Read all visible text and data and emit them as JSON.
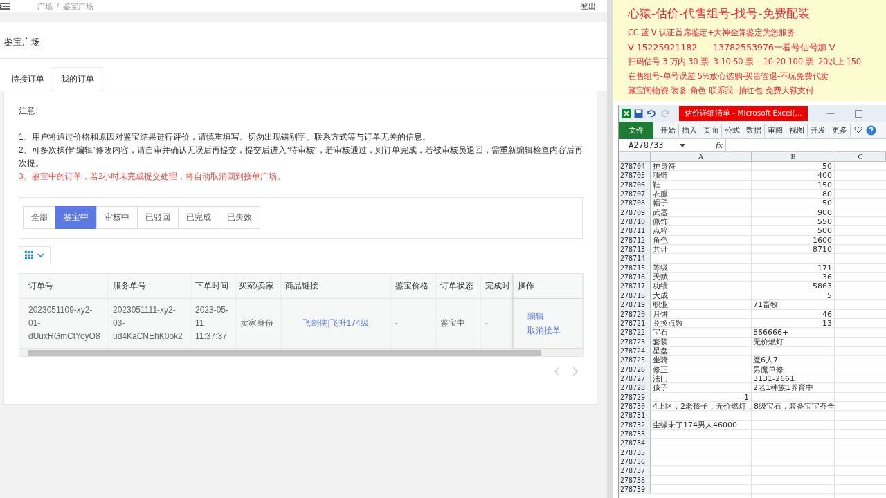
{
  "header": {
    "breadcrumb": [
      "广场",
      "鉴宝广场"
    ],
    "separator": "/",
    "logout": "登出"
  },
  "page_title": "鉴宝广场",
  "tabs": [
    {
      "label": "待接订单",
      "selected": false
    },
    {
      "label": "我的订单",
      "selected": true
    }
  ],
  "notice": {
    "heading": "注意:",
    "items": [
      {
        "text": "1、用户将通过价格和原因对鉴宝结果进行评价，请慎重填写。切勿出现错别字、联系方式等与订单无关的信息。",
        "warning": false
      },
      {
        "text": "2、可多次操作“编辑”修改内容，请自审并确认无误后再提交，提交后进入“待审核”，若审核通过，则订单完成，若被审核员退回，需重新编辑检查内容后再次提。",
        "warning": false
      },
      {
        "text": "3、鉴宝中的订单，若2小时未完成提交处理，将自动取消回到接单广场。",
        "warning": true
      }
    ]
  },
  "filters": [
    {
      "label": "全部",
      "selected": false
    },
    {
      "label": "鉴宝中",
      "selected": true
    },
    {
      "label": "审核中",
      "selected": false
    },
    {
      "label": "已驳回",
      "selected": false
    },
    {
      "label": "已完成",
      "selected": false
    },
    {
      "label": "已失效",
      "selected": false
    }
  ],
  "table": {
    "columns": [
      "订单号",
      "服务单号",
      "下单时间",
      "买家/卖家",
      "商品链接",
      "鉴宝价格",
      "订单状态",
      "完成时",
      "操作"
    ],
    "rows": [
      {
        "cells": [
          {
            "kind": "text",
            "text": "2023051109-xy2-01-dUuxRGmCtYoyO8"
          },
          {
            "kind": "text",
            "text": "2023051111-xy2-03-ud4KaCNEhK0ok2"
          },
          {
            "kind": "text",
            "text": "2023-05-11 11:37:37"
          },
          {
            "kind": "text",
            "text": "卖家身份"
          },
          {
            "kind": "link",
            "text": "飞剑侠|飞升174级"
          },
          {
            "kind": "muted",
            "text": "-"
          },
          {
            "kind": "text",
            "text": "鉴宝中"
          },
          {
            "kind": "muted",
            "text": "-"
          }
        ],
        "actions": [
          "编辑",
          "取消接单"
        ]
      }
    ]
  },
  "ad": {
    "headline": "心猿-估价-代售组号-找号-免费配装",
    "lines": [
      "CC 蓝 V 认证首席鉴定+大神金牌鉴定为您服务",
      "V 15225921182      13782553976一看号估号加 V",
      "扫码估号 3 万内 30 票- 3-10-50 票  --10-20-100 票- 20以上 150",
      "在售组号-单号误差 5%放心选购-买贵管退-不玩免费代卖",
      "藏宝阁物资-装备-角色-联系我--抽红包-免费大额支付"
    ]
  },
  "excel": {
    "title": "估价详细清单 - Microsoft Excel(...",
    "ribbon": [
      {
        "label": "文件",
        "selected": true
      },
      {
        "label": "开始",
        "selected": false
      },
      {
        "label": "插入",
        "selected": false
      },
      {
        "label": "页面",
        "selected": false
      },
      {
        "label": "公式",
        "selected": false
      },
      {
        "label": "数据",
        "selected": false
      },
      {
        "label": "审阅",
        "selected": false
      },
      {
        "label": "视图",
        "selected": false
      },
      {
        "label": "开发",
        "selected": false
      },
      {
        "label": "更多",
        "selected": false
      }
    ],
    "name_box": "A278733",
    "formula_label": "fx",
    "columns": [
      "A",
      "B",
      "C"
    ],
    "rows": [
      {
        "num": "278704",
        "cells": [
          {
            "kind": "text",
            "text": "护身符"
          },
          {
            "kind": "number",
            "text": "50"
          }
        ]
      },
      {
        "num": "278705",
        "cells": [
          {
            "kind": "text",
            "text": "项链"
          },
          {
            "kind": "number",
            "text": "400"
          }
        ]
      },
      {
        "num": "278706",
        "cells": [
          {
            "kind": "text",
            "text": "鞋"
          },
          {
            "kind": "number",
            "text": "150"
          }
        ]
      },
      {
        "num": "278707",
        "cells": [
          {
            "kind": "text",
            "text": "衣服"
          },
          {
            "kind": "number",
            "text": "80"
          }
        ]
      },
      {
        "num": "278708",
        "cells": [
          {
            "kind": "text",
            "text": "帽子"
          },
          {
            "kind": "number",
            "text": "50"
          }
        ]
      },
      {
        "num": "278709",
        "cells": [
          {
            "kind": "text",
            "text": "武器"
          },
          {
            "kind": "number",
            "text": "900"
          }
        ]
      },
      {
        "num": "278710",
        "cells": [
          {
            "kind": "text",
            "text": "佩饰"
          },
          {
            "kind": "number",
            "text": "550"
          }
        ]
      },
      {
        "num": "278711",
        "cells": [
          {
            "kind": "text",
            "text": "点粹"
          },
          {
            "kind": "number",
            "text": "500"
          }
        ]
      },
      {
        "num": "278712",
        "cells": [
          {
            "kind": "text",
            "text": "角色"
          },
          {
            "kind": "number",
            "text": "1600"
          }
        ]
      },
      {
        "num": "278713",
        "cells": [
          {
            "kind": "text",
            "text": "共计"
          },
          {
            "kind": "number",
            "text": "8710"
          }
        ]
      },
      {
        "num": "278714"
      },
      {
        "num": "278715",
        "cells": [
          {
            "kind": "text",
            "text": "等级"
          },
          {
            "kind": "number",
            "text": "171"
          }
        ]
      },
      {
        "num": "278716",
        "cells": [
          {
            "kind": "text",
            "text": "天赋"
          },
          {
            "kind": "number",
            "text": "36"
          }
        ]
      },
      {
        "num": "278717",
        "cells": [
          {
            "kind": "text",
            "text": "功绩"
          },
          {
            "kind": "number",
            "text": "5863"
          }
        ]
      },
      {
        "num": "278718",
        "cells": [
          {
            "kind": "text",
            "text": "大成"
          },
          {
            "kind": "number",
            "text": "5"
          }
        ]
      },
      {
        "num": "278719",
        "cells": [
          {
            "kind": "text",
            "text": "职业"
          },
          {
            "kind": "text",
            "text": "71畜牧"
          }
        ]
      },
      {
        "num": "278720",
        "cells": [
          {
            "kind": "text",
            "text": "月饼"
          },
          {
            "kind": "number",
            "text": "46"
          }
        ]
      },
      {
        "num": "278721",
        "cells": [
          {
            "kind": "text",
            "text": "兑换点数"
          },
          {
            "kind": "number",
            "text": "13"
          }
        ]
      },
      {
        "num": "278722",
        "cells": [
          {
            "kind": "text",
            "text": "宝石"
          },
          {
            "kind": "text",
            "text": "866666+"
          }
        ]
      },
      {
        "num": "278723",
        "cells": [
          {
            "kind": "text",
            "text": "套装"
          },
          {
            "kind": "text",
            "text": "无价燃灯"
          }
        ]
      },
      {
        "num": "278724",
        "cells": [
          {
            "kind": "text",
            "text": "星盘"
          }
        ]
      },
      {
        "num": "278725",
        "cells": [
          {
            "kind": "text",
            "text": "坐骑"
          },
          {
            "kind": "text",
            "text": "魔6人7"
          }
        ]
      },
      {
        "num": "278726",
        "cells": [
          {
            "kind": "text",
            "text": "修正"
          },
          {
            "kind": "text",
            "text": "男魔单修"
          }
        ]
      },
      {
        "num": "278727",
        "cells": [
          {
            "kind": "text",
            "text": "法门"
          },
          {
            "kind": "text",
            "text": "3131-2661"
          }
        ]
      },
      {
        "num": "278728",
        "cells": [
          {
            "kind": "text",
            "text": "孩子"
          },
          {
            "kind": "text",
            "text": "2老1种族1养育中"
          }
        ]
      },
      {
        "num": "278729",
        "cells": [
          {
            "kind": "number",
            "text": "1"
          }
        ]
      },
      {
        "num": "278730",
        "cells": [
          {
            "kind": "text",
            "text": "4上区，2老孩子，无价燃灯，8级宝石，装备宝宝齐全"
          }
        ]
      },
      {
        "num": "278731"
      },
      {
        "num": "278732",
        "cells": [
          {
            "kind": "text",
            "text": "尘缘未了174男人46000"
          }
        ]
      },
      {
        "num": "278733"
      },
      {
        "num": "278734"
      },
      {
        "num": "278735"
      },
      {
        "num": "278736"
      },
      {
        "num": "278737"
      },
      {
        "num": "278738"
      },
      {
        "num": "278739"
      }
    ]
  }
}
